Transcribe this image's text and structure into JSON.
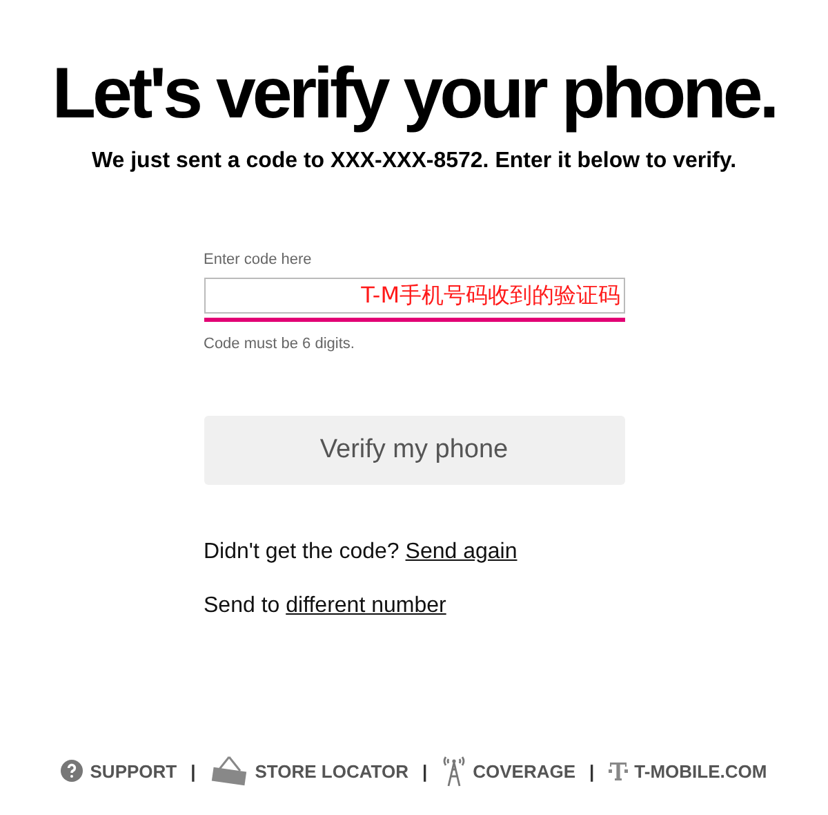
{
  "heading": "Let's verify your phone.",
  "subheading": "We just sent a code to XXX-XXX-8572. Enter it below to verify.",
  "code_field": {
    "label": "Enter code here",
    "annotation": "T-M手机号码收到的验证码",
    "hint": "Code must be 6 digits."
  },
  "verify_button": {
    "label": "Verify my phone",
    "disabled": true
  },
  "resend": {
    "text": "Didn't get the code?",
    "link": "Send again"
  },
  "change_number": {
    "text": "Send to",
    "link": "different number"
  },
  "footer_links": [
    {
      "kind": "support",
      "label": "SUPPORT"
    },
    {
      "kind": "store",
      "label": "STORE LOCATOR"
    },
    {
      "kind": "coverage",
      "label": "COVERAGE"
    },
    {
      "kind": "brand",
      "label": "T-MOBILE.COM"
    }
  ],
  "footer_separator": "|"
}
